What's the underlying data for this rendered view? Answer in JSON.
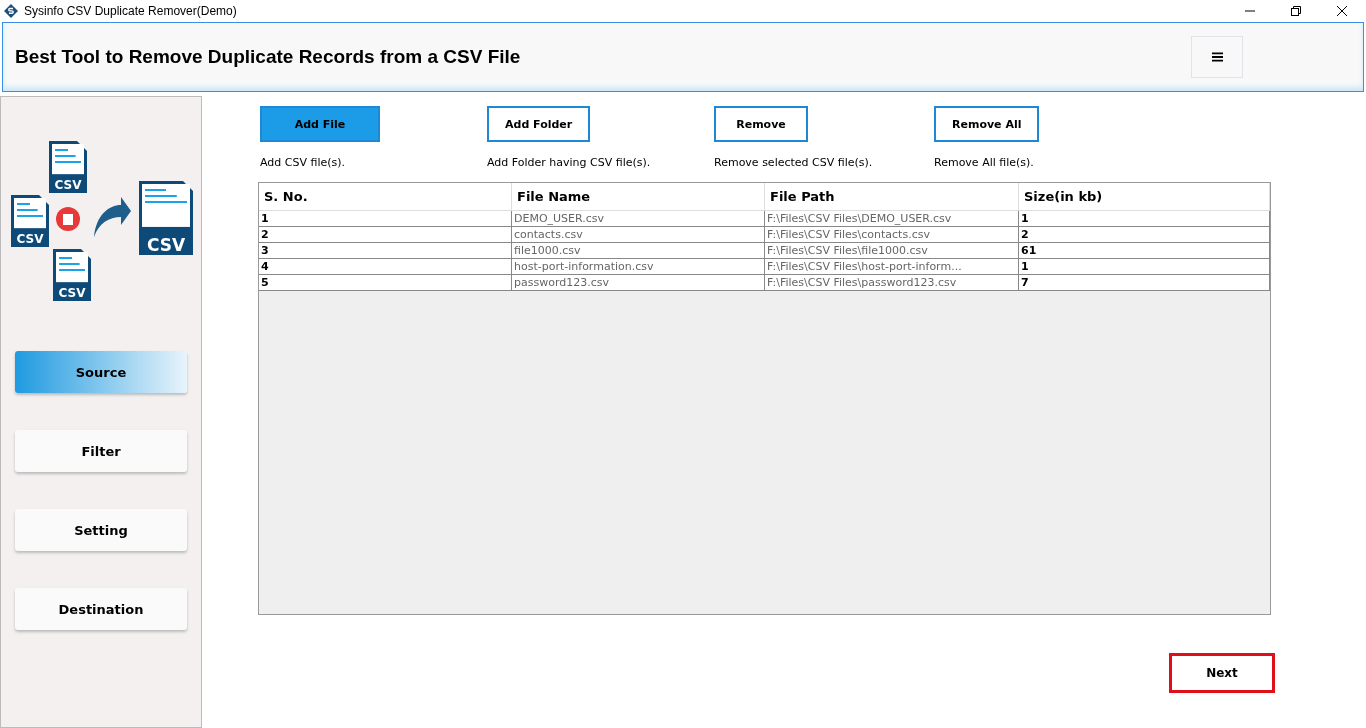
{
  "window": {
    "title": "Sysinfo CSV Duplicate Remover(Demo)"
  },
  "header": {
    "title": "Best Tool to Remove Duplicate Records from a CSV File"
  },
  "illustration": {
    "file_labels": [
      "CSV",
      "CSV",
      "CSV",
      "CSV"
    ]
  },
  "sidebar": {
    "items": [
      {
        "label": "Source",
        "selected": true
      },
      {
        "label": "Filter",
        "selected": false
      },
      {
        "label": "Setting",
        "selected": false
      },
      {
        "label": "Destination",
        "selected": false
      }
    ]
  },
  "actions": [
    {
      "label": "Add File",
      "hint": "Add CSV file(s).",
      "selected": true
    },
    {
      "label": "Add Folder",
      "hint": "Add Folder having CSV file(s).",
      "selected": false
    },
    {
      "label": "Remove",
      "hint": "Remove selected CSV file(s).",
      "selected": false
    },
    {
      "label": "Remove All",
      "hint": "Remove All file(s).",
      "selected": false
    }
  ],
  "table": {
    "columns": [
      "S. No.",
      "File Name",
      "File Path",
      "Size(in kb)"
    ],
    "rows": [
      [
        "1",
        "DEMO_USER.csv",
        "F:\\Files\\CSV Files\\DEMO_USER.csv",
        "1"
      ],
      [
        "2",
        "contacts.csv",
        "F:\\Files\\CSV Files\\contacts.csv",
        "2"
      ],
      [
        "3",
        "file1000.csv",
        "F:\\Files\\CSV Files\\file1000.csv",
        "61"
      ],
      [
        "4",
        "host-port-information.csv",
        "F:\\Files\\CSV Files\\host-port-inform...",
        "1"
      ],
      [
        "5",
        "password123.csv",
        "F:\\Files\\CSV Files\\password123.csv",
        "7"
      ]
    ]
  },
  "footer": {
    "next": "Next"
  }
}
